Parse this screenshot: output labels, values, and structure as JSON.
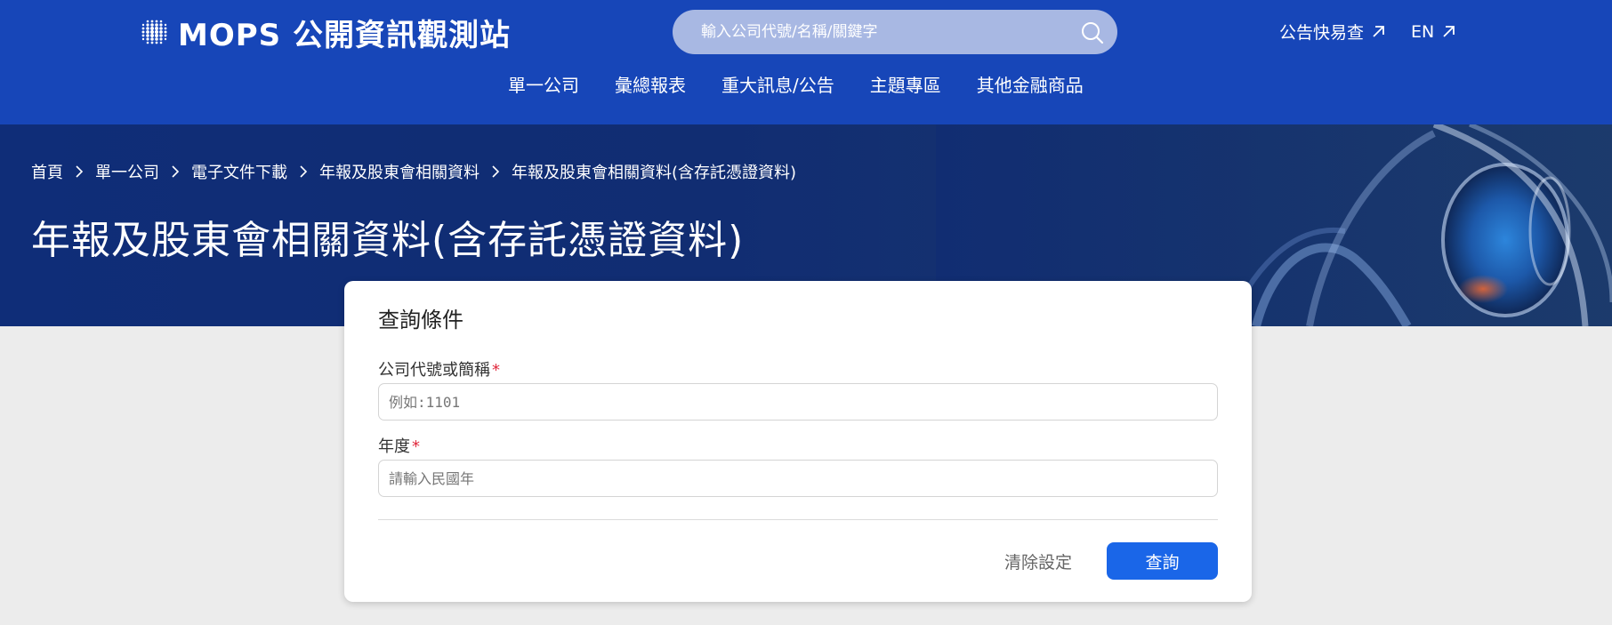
{
  "colors": {
    "header_bg": "#1746b8",
    "banner_bg": "#112d72",
    "primary_button": "#1a66e8",
    "required_mark": "#e0283c",
    "page_bg": "#ececec"
  },
  "header": {
    "logo_text": "MOPS 公開資訊觀測站",
    "logo_icon": "dot-grid-icon",
    "search": {
      "placeholder": "輸入公司代號/名稱/關鍵字",
      "icon": "search-icon"
    },
    "top_links": [
      {
        "label": "公告快易查",
        "icon": "external-link-icon"
      },
      {
        "label": "EN",
        "icon": "external-link-icon"
      }
    ],
    "nav": [
      "單一公司",
      "彙總報表",
      "重大訊息/公告",
      "主題專區",
      "其他金融商品"
    ]
  },
  "banner": {
    "breadcrumb": [
      "首頁",
      "單一公司",
      "電子文件下載",
      "年報及股東會相關資料",
      "年報及股東會相關資料(含存託憑證資料)"
    ],
    "title": "年報及股東會相關資料(含存託憑證資料)"
  },
  "query_card": {
    "title": "查詢條件",
    "fields": [
      {
        "label": "公司代號或簡稱",
        "required_mark": "*",
        "placeholder": "例如:1101",
        "value": ""
      },
      {
        "label": "年度",
        "required_mark": "*",
        "placeholder": "請輸入民國年",
        "value": ""
      }
    ],
    "clear_label": "清除設定",
    "submit_label": "查詢"
  }
}
